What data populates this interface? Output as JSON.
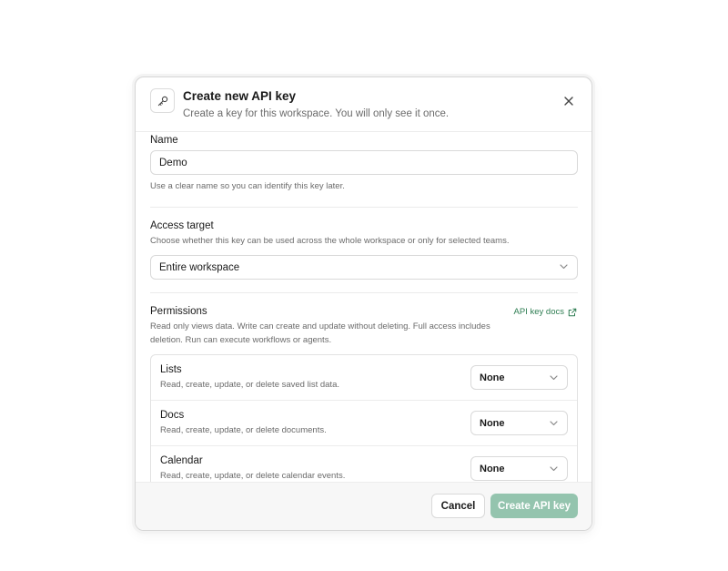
{
  "dialog": {
    "title": "Create new API key",
    "subtitle": "Create a key for this workspace. You will only see it once."
  },
  "name_field": {
    "label": "Name",
    "value": "Demo",
    "help": "Use a clear name so you can identify this key later."
  },
  "access_target": {
    "label": "Access target",
    "help": "Choose whether this key can be used across the whole workspace or only for selected teams.",
    "selected": "Entire workspace"
  },
  "permissions": {
    "label": "Permissions",
    "docs_link": "API key docs",
    "help_line1": "Read only views data. Write can create and update without deleting. Full access includes",
    "help_line2": "deletion. Run can execute workflows or agents.",
    "items": [
      {
        "name": "Lists",
        "description": "Read, create, update, or delete saved list data.",
        "level": "None"
      },
      {
        "name": "Docs",
        "description": "Read, create, update, or delete documents.",
        "level": "None"
      },
      {
        "name": "Calendar",
        "description": "Read, create, update, or delete calendar events.",
        "level": "None"
      }
    ]
  },
  "footer": {
    "cancel_label": "Cancel",
    "create_label": "Create API key"
  },
  "colors": {
    "accent_link": "#2e7d52",
    "primary_disabled": "#94c4ae"
  }
}
